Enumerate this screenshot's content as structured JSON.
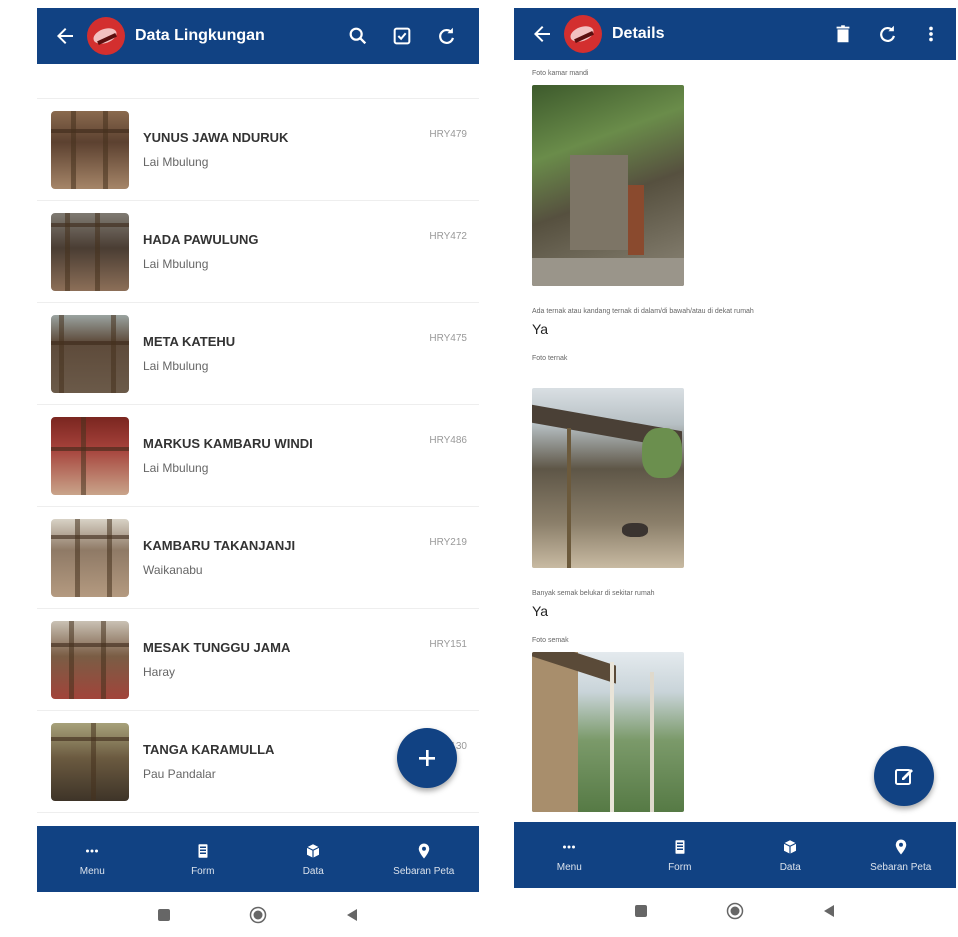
{
  "left_screen": {
    "title": "Data Lingkungan",
    "icons": {
      "back": "arrow-left-icon",
      "search": "search-icon",
      "select": "checkbox-icon",
      "refresh": "refresh-icon",
      "add": "plus-icon"
    },
    "items": [
      {
        "name": "YUNUS JAWA NDURUK",
        "place": "Lai Mbulung",
        "code": "HRY479"
      },
      {
        "name": "HADA PAWULUNG",
        "place": "Lai Mbulung",
        "code": "HRY472"
      },
      {
        "name": "META KATEHU",
        "place": "Lai Mbulung",
        "code": "HRY475"
      },
      {
        "name": "MARKUS KAMBARU WINDI",
        "place": "Lai Mbulung",
        "code": "HRY486"
      },
      {
        "name": "KAMBARU TAKANJANJI",
        "place": "Waikanabu",
        "code": "HRY219"
      },
      {
        "name": "MESAK TUNGGU JAMA",
        "place": "Haray",
        "code": "HRY151"
      },
      {
        "name": "TANGA KARAMULLA",
        "place": "Pau Pandalar",
        "code": "HRY130"
      }
    ]
  },
  "right_screen": {
    "title": "Details",
    "icons": {
      "back": "arrow-left-icon",
      "delete": "trash-icon",
      "refresh": "refresh-icon",
      "more": "more-vert-icon",
      "edit": "edit-icon"
    },
    "fields": {
      "foto_kamar_mandi_label": "Foto kamar mandi",
      "ternak_label": "Ada ternak atau kandang ternak di dalam/di bawah/atau di dekat rumah",
      "ternak_value": "Ya",
      "foto_ternak_label": "Foto ternak",
      "semak_label": "Banyak semak belukar di sekitar rumah",
      "semak_value": "Ya",
      "foto_semak_label": "Foto semak"
    }
  },
  "bottom_nav": [
    {
      "label": "Menu",
      "icon": "more-horiz-icon"
    },
    {
      "label": "Form",
      "icon": "form-icon"
    },
    {
      "label": "Data",
      "icon": "box-icon"
    },
    {
      "label": "Sebaran Peta",
      "icon": "map-pin-icon"
    }
  ],
  "system_nav": {
    "recents": "square-icon",
    "home": "circle-icon",
    "back": "triangle-back-icon"
  },
  "colors": {
    "primary": "#114283",
    "avatar_red": "#d32f2f"
  }
}
